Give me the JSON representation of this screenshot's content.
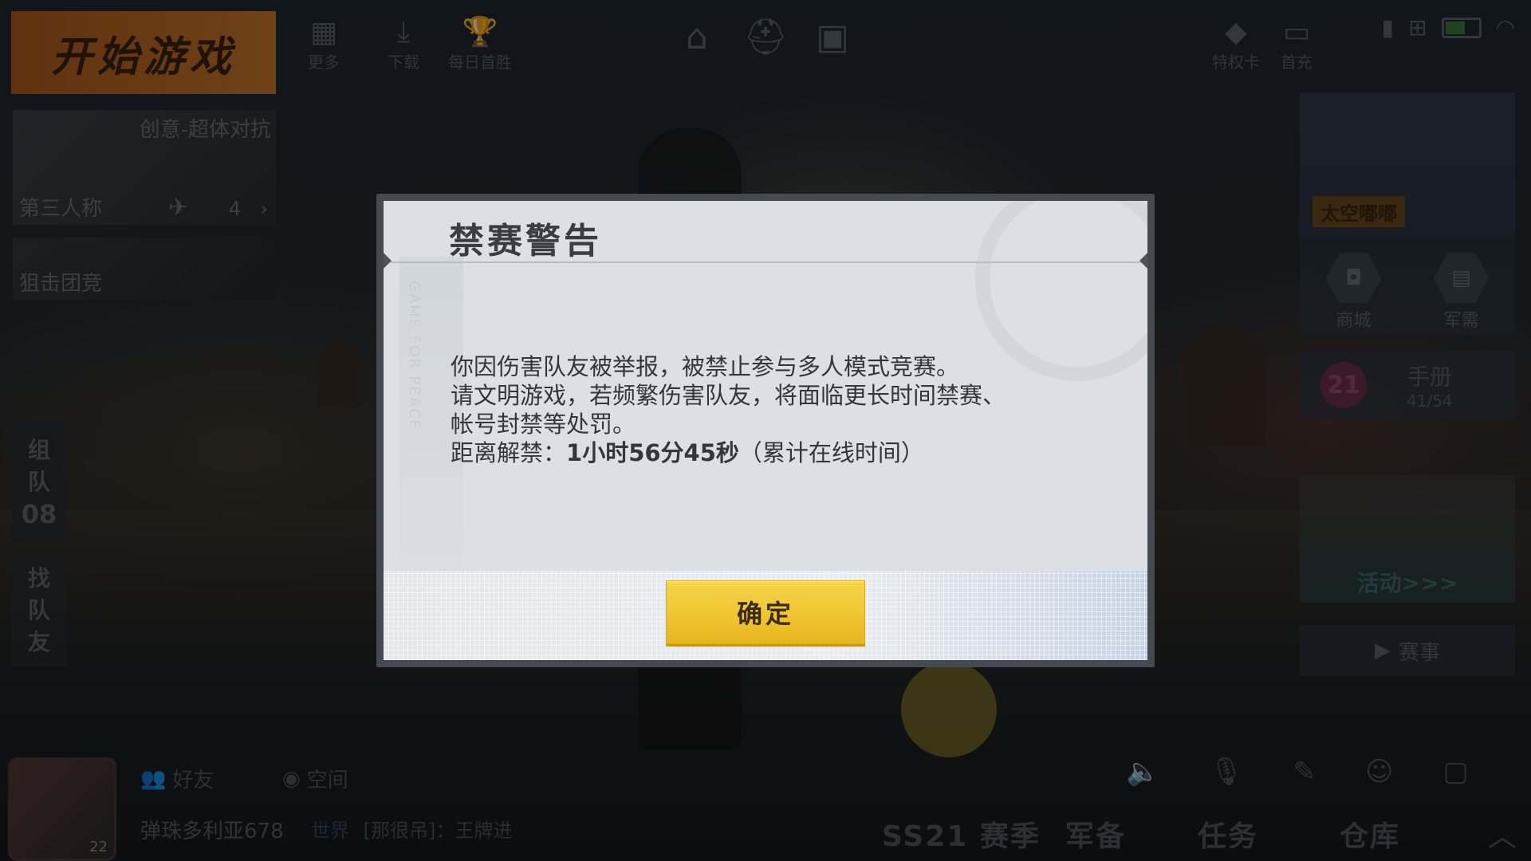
{
  "top_bar": {
    "start_game": "开始游戏",
    "more": "更多",
    "download": "下载",
    "daily_win": "每日首胜",
    "privilege_card": "特权卡",
    "first_recharge": "首充"
  },
  "left_panel": {
    "mode_name": "创意-超体对抗",
    "perspective": "第三人称",
    "squad_size": "4",
    "sub_mode": "狙击团竞",
    "team_tab": [
      "组",
      "队"
    ],
    "team_count": "08",
    "find_team": [
      "找",
      "队",
      "友"
    ]
  },
  "right_panel": {
    "space_tag": "太空嘟嘟",
    "shop": "商城",
    "supplies": "军需",
    "manual_level": "21",
    "manual": "手册",
    "manual_progress": "41/54",
    "events": "活动>>>",
    "matches": "赛事"
  },
  "bottom_bar": {
    "friends": "好友",
    "space": "空间",
    "player_name": "弹珠多利亚678",
    "player_level": "22",
    "chat_channel": "世界",
    "chat_message": "[那很吊]：王牌进",
    "season": "SS21 赛季",
    "armory": "军备",
    "missions": "任务",
    "warehouse": "仓库"
  },
  "dialog": {
    "title": "禁赛警告",
    "watermark": "GAME FOR PEACE",
    "line1": "你因伤害队友被举报，被禁止参与多人模式竞赛。",
    "line2": "请文明游戏，若频繁伤害队友，将面临更长时间禁赛、",
    "line3": "帐号封禁等处罚。",
    "countdown_prefix": "距离解禁：",
    "countdown_value": "1小时56分45秒",
    "countdown_suffix": "（累计在线时间）",
    "confirm": "确定"
  }
}
